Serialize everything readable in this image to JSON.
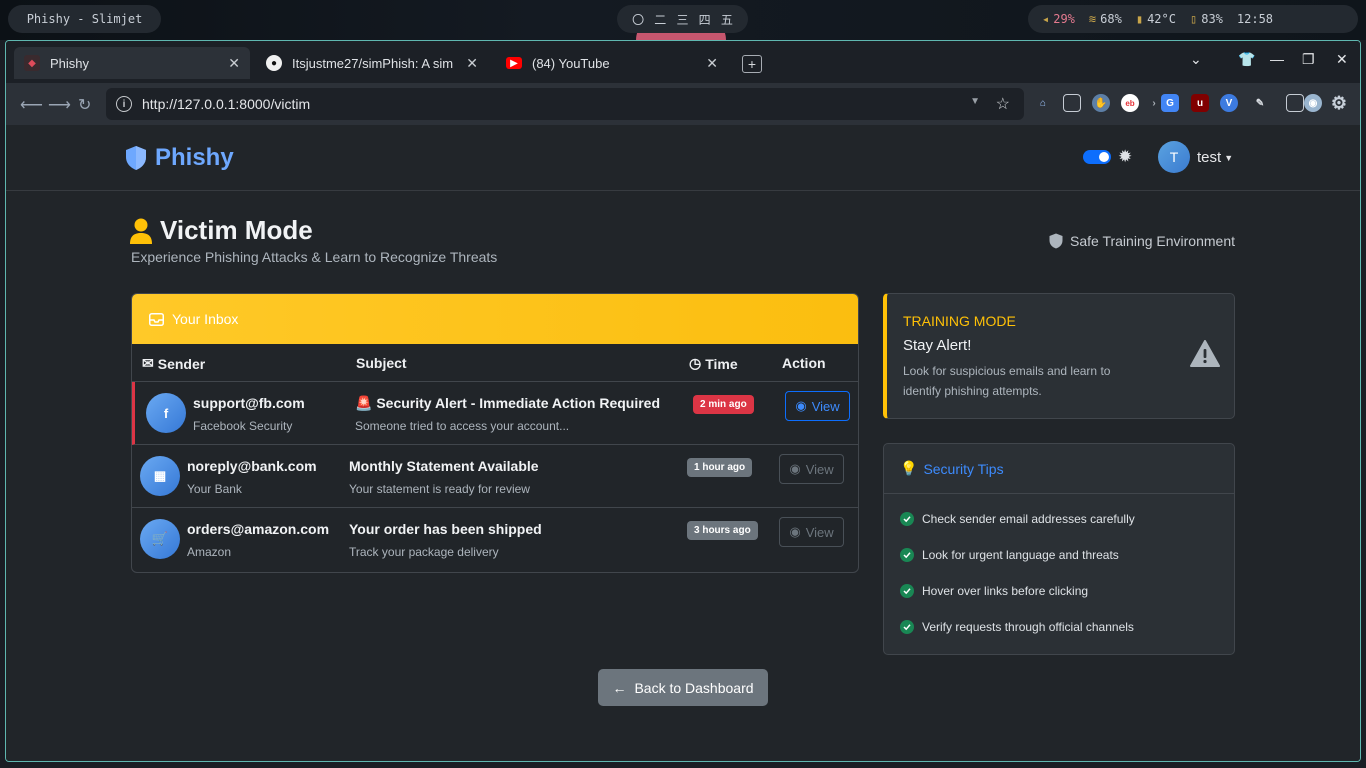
{
  "desktop": {
    "window_title": "Phishy - Slimjet",
    "workspaces": [
      "〇",
      "二",
      "三",
      "四",
      "五"
    ],
    "volume": "29%",
    "wifi": "68%",
    "temp": "42°C",
    "battery": "83%",
    "clock": "12:58"
  },
  "browser": {
    "tabs": [
      {
        "title": "Phishy",
        "active": true
      },
      {
        "title": "Itsjustme27/simPhish: A sim",
        "active": false
      },
      {
        "title": "(84) YouTube",
        "active": false
      }
    ],
    "url": "http://127.0.0.1:8000/victim"
  },
  "navbar": {
    "brand": "Phishy",
    "avatar_initial": "T",
    "username": "test"
  },
  "hero": {
    "title": "Victim Mode",
    "subtitle": "Experience Phishing Attacks & Learn to Recognize Threats",
    "safe_env": "Safe Training Environment"
  },
  "inbox": {
    "title": "Your Inbox",
    "headers": {
      "sender": "Sender",
      "subject": "Subject",
      "time": "Time",
      "action": "Action"
    },
    "emails": [
      {
        "from": "support@fb.com",
        "name": "Facebook Security",
        "subject": "🚨 Security Alert - Immediate Action Required",
        "preview": "Someone tried to access your account...",
        "time": "2 min ago",
        "action": "View"
      },
      {
        "from": "noreply@bank.com",
        "name": "Your Bank",
        "subject": "Monthly Statement Available",
        "preview": "Your statement is ready for review",
        "time": "1 hour ago",
        "action": "View"
      },
      {
        "from": "orders@amazon.com",
        "name": "Amazon",
        "subject": "Your order has been shipped",
        "preview": "Track your package delivery",
        "time": "3 hours ago",
        "action": "View"
      }
    ]
  },
  "training": {
    "label": "TRAINING MODE",
    "title": "Stay Alert!",
    "text": "Look for suspicious emails and learn to identify phishing attempts."
  },
  "tips": {
    "title": "Security Tips",
    "items": [
      "Check sender email addresses carefully",
      "Look for urgent language and threats",
      "Hover over links before clicking",
      "Verify requests through official channels"
    ]
  },
  "back_button": "Back to Dashboard",
  "colors": {
    "accent": "#0d6efd",
    "warning": "#ffc107",
    "danger": "#dc3545",
    "success": "#198754"
  }
}
